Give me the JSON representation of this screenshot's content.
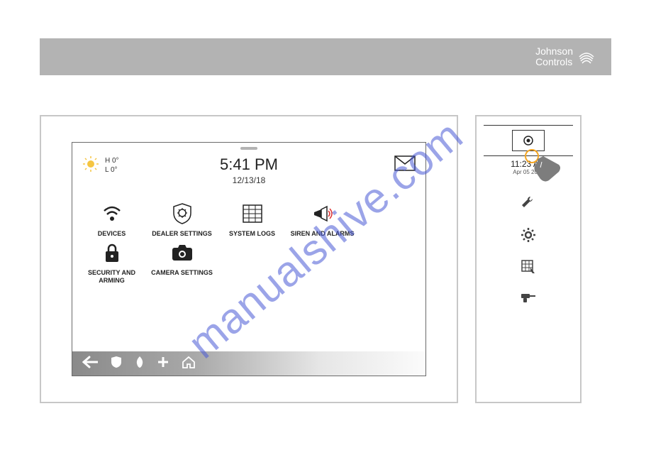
{
  "header": {
    "brand_line1": "Johnson",
    "brand_line2": "Controls"
  },
  "watermark": "manualshive.com",
  "panel": {
    "weather": {
      "high": "H 0°",
      "low": "L 0°"
    },
    "time": "5:41 PM",
    "date": "12/13/18",
    "tiles": [
      {
        "key": "devices",
        "label": "DEVICES",
        "icon": "wifi-icon"
      },
      {
        "key": "dealer-settings",
        "label": "DEALER SETTINGS",
        "icon": "shield-gear-icon"
      },
      {
        "key": "system-logs",
        "label": "SYSTEM LOGS",
        "icon": "table-icon"
      },
      {
        "key": "siren-alarms",
        "label": "SIREN AND ALARMS",
        "icon": "megaphone-icon"
      },
      {
        "key": "security-arming",
        "label": "SECURITY AND ARMING",
        "icon": "lock-icon"
      },
      {
        "key": "camera-settings",
        "label": "CAMERA SETTINGS",
        "icon": "camera-icon"
      }
    ],
    "bottom_icons": [
      "back-arrow-icon",
      "shield-icon",
      "flame-icon",
      "plus-icon",
      "home-icon"
    ]
  },
  "side": {
    "time": "11:23 AM",
    "date": "Apr 05 2021",
    "tools": [
      "wrench-icon",
      "gear-icon",
      "touch-panel-icon",
      "drill-icon"
    ]
  }
}
